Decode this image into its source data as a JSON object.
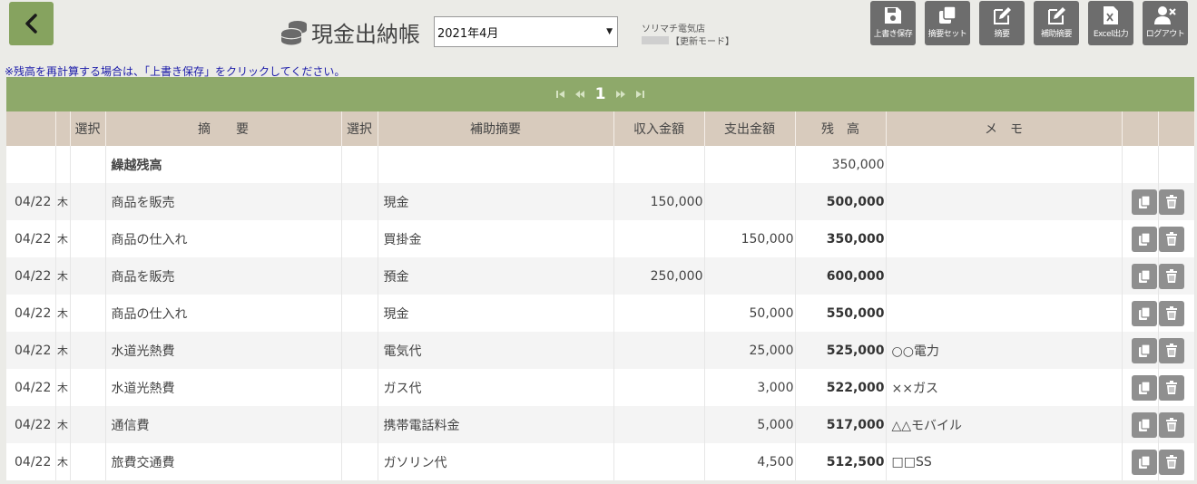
{
  "header": {
    "title": "現金出納帳",
    "month": "2021年4月",
    "shop": "ソリマチ電気店",
    "mode": "【更新モード】"
  },
  "toolbar": [
    {
      "label": "上書き保存",
      "icon": "save-icon"
    },
    {
      "label": "摘要セット",
      "icon": "copy-set-icon"
    },
    {
      "label": "摘要",
      "icon": "edit-icon"
    },
    {
      "label": "補助摘要",
      "icon": "edit-icon"
    },
    {
      "label": "Excel出力",
      "icon": "excel-icon"
    },
    {
      "label": "ログアウト",
      "icon": "logout-icon"
    }
  ],
  "notice": "※残高を再計算する場合は、「上書き保存」をクリックしてください。",
  "pager": {
    "current": "1"
  },
  "columns": [
    "選択",
    "摘　　要",
    "選択",
    "補助摘要",
    "収入金額",
    "支出金額",
    "残　高",
    "メ　モ"
  ],
  "carry_row": {
    "label": "繰越残高",
    "balance": "350,000"
  },
  "rows": [
    {
      "date": "04/22",
      "dow": "木",
      "summary": "商品を販売",
      "sub": "現金",
      "income": "150,000",
      "expense": "",
      "balance": "500,000",
      "memo": ""
    },
    {
      "date": "04/22",
      "dow": "木",
      "summary": "商品の仕入れ",
      "sub": "買掛金",
      "income": "",
      "expense": "150,000",
      "balance": "350,000",
      "memo": ""
    },
    {
      "date": "04/22",
      "dow": "木",
      "summary": "商品を販売",
      "sub": "預金",
      "income": "250,000",
      "expense": "",
      "balance": "600,000",
      "memo": ""
    },
    {
      "date": "04/22",
      "dow": "木",
      "summary": "商品の仕入れ",
      "sub": "現金",
      "income": "",
      "expense": "50,000",
      "balance": "550,000",
      "memo": ""
    },
    {
      "date": "04/22",
      "dow": "木",
      "summary": "水道光熱費",
      "sub": "電気代",
      "income": "",
      "expense": "25,000",
      "balance": "525,000",
      "memo": "○○電力"
    },
    {
      "date": "04/22",
      "dow": "木",
      "summary": "水道光熱費",
      "sub": "ガス代",
      "income": "",
      "expense": "3,000",
      "balance": "522,000",
      "memo": "××ガス"
    },
    {
      "date": "04/22",
      "dow": "木",
      "summary": "通信費",
      "sub": "携帯電話料金",
      "income": "",
      "expense": "5,000",
      "balance": "517,000",
      "memo": "△△モバイル"
    },
    {
      "date": "04/22",
      "dow": "木",
      "summary": "旅費交通費",
      "sub": "ガソリン代",
      "income": "",
      "expense": "4,500",
      "balance": "512,500",
      "memo": "□□SS"
    }
  ]
}
